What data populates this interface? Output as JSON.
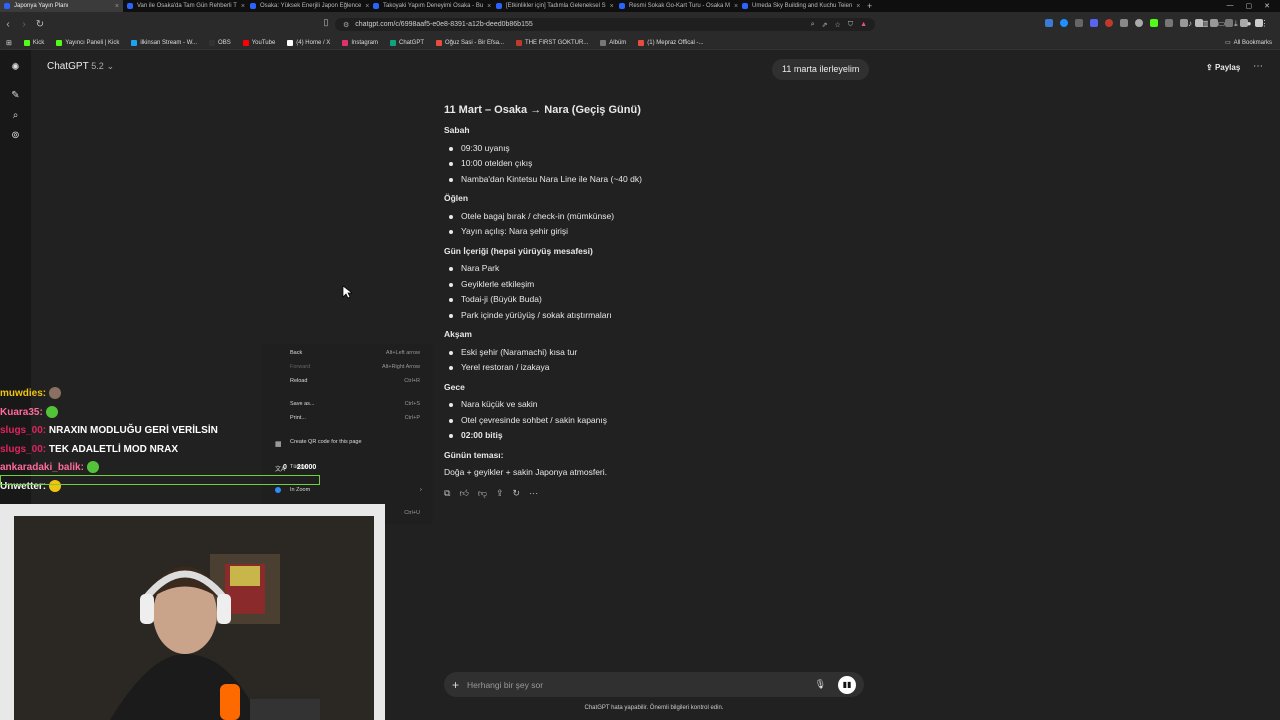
{
  "browser": {
    "tabs": [
      {
        "label": "Japonya Yayın Planı",
        "active": true
      },
      {
        "label": "Van ile Osaka'da Tam Gün Rehberli T"
      },
      {
        "label": "Osaka: Yüksek Enerjili Japon Eğlence"
      },
      {
        "label": "Takoyaki Yapım Deneyimi Osaka - Bu"
      },
      {
        "label": "[Etkinlikler için] Tadımla Geleneksel S"
      },
      {
        "label": "Resmi Sokak Go-Kart Turu - Osaka M"
      },
      {
        "label": "Umeda Sky Building and Kuchu Teien"
      }
    ],
    "url": "chatgpt.com/c/6998aaf5-e0e8-8391-a12b-deed0b86b155",
    "bookmarks": [
      "Kick",
      "Yayıncı Paneli | Kick",
      "ilkinsan Stream - W...",
      "OBS",
      "YouTube",
      "(4) Home / X",
      "Instagram",
      "ChatGPT",
      "Oğuz Sasi - Bir Efsa...",
      "THE FIRST GOKTUR...",
      "Albüm",
      "(1) Mepraz Offical -..."
    ],
    "all_bookmarks": "All Bookmarks"
  },
  "header": {
    "model": "ChatGPT",
    "version": "5.2",
    "pill": "11 marta ilerleyelim",
    "share": "Paylaş"
  },
  "plan": {
    "title": "11 Mart – Osaka → Nara (Geçiş Günü)",
    "sections": [
      {
        "heading": "Sabah",
        "items": [
          "09:30 uyanış",
          "10:00 otelden çıkış",
          "Namba'dan Kintetsu Nara Line ile Nara (~40 dk)"
        ]
      },
      {
        "heading": "Öğlen",
        "items": [
          "Otele bagaj bırak / check-in (mümkünse)",
          "Yayın açılış: Nara şehir girişi"
        ]
      },
      {
        "heading": "Gün İçeriği (hepsi yürüyüş mesafesi)",
        "items": [
          "Nara Park",
          "Geyiklerle etkileşim",
          "Todai-ji (Büyük Buda)",
          "Park içinde yürüyüş / sokak atıştırmaları"
        ]
      },
      {
        "heading": "Akşam",
        "items": [
          "Eski şehir (Naramachi) kısa tur",
          "Yerel restoran / izakaya"
        ]
      },
      {
        "heading": "Gece",
        "items": [
          "Nara küçük ve sakin",
          "Otel çevresinde sohbet / sakin kapanış",
          "02:00 bitiş"
        ]
      }
    ],
    "theme_label": "Günün teması:",
    "theme": "Doğa + geyikler + sakin Japonya atmosferi."
  },
  "input": {
    "placeholder": "Herhangi bir şey sor",
    "disclaimer": "ChatGPT hata yapabilir. Önemli bilgileri kontrol edin."
  },
  "context_menu": [
    {
      "label": "Back",
      "shortcut": "Alt+Left arrow"
    },
    {
      "label": "Forward",
      "shortcut": "Alt+Right Arrow",
      "disabled": true
    },
    {
      "label": "Reload",
      "shortcut": "Ctrl+R"
    },
    {
      "label": "Save as...",
      "shortcut": "Ctrl+S"
    },
    {
      "label": "Print...",
      "shortcut": "Ctrl+P"
    },
    {
      "label": "Create QR code for this page",
      "shortcut": ""
    },
    {
      "label": "Türkçe",
      "shortcut": ""
    },
    {
      "label": "In Zoom",
      "shortcut": ""
    },
    {
      "label": "",
      "shortcut": "Ctrl+U"
    }
  ],
  "overlay": {
    "chat": [
      {
        "user": "muwdies:",
        "msg": "",
        "color": "#f1c40f"
      },
      {
        "user": "Kuara35:",
        "msg": "",
        "color": "#ff6b9a"
      },
      {
        "user": "slugs_00:",
        "msg": " NRAXIN MODLUĞU GERİ VERİLSİN",
        "color": "#e0245e"
      },
      {
        "user": "slugs_00:",
        "msg": " TEK ADALETLİ MOD NRAX",
        "color": "#e0245e"
      },
      {
        "user": "ankaradaki_balik:",
        "msg": "",
        "color": "#ff6b9a"
      },
      {
        "user": "Unwetter:",
        "msg": "",
        "color": "#f5f5f5"
      }
    ],
    "goal_count": "0",
    "goal_total": "21000"
  }
}
